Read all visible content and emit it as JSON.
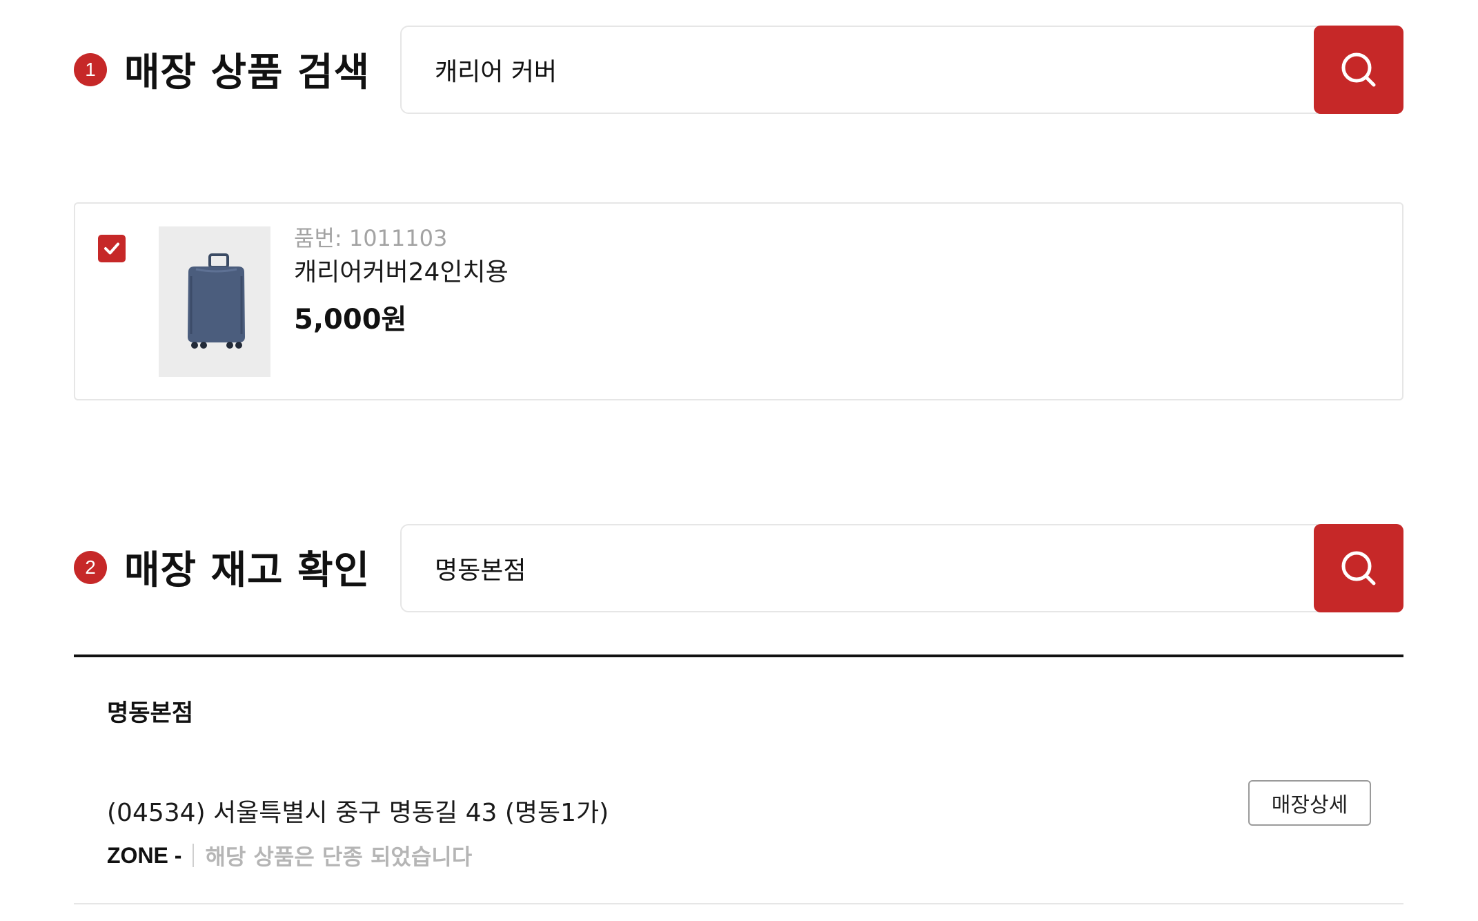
{
  "section1": {
    "step_number": "1",
    "title": "매장 상품 검색",
    "search_value": "캐리어 커버",
    "search_icon": "search-icon"
  },
  "product": {
    "checked": true,
    "sku": "품번: 1011103",
    "name": "캐리어커버24인치용",
    "price": "5,000원",
    "image": "luggage-cover-image"
  },
  "section2": {
    "step_number": "2",
    "title": "매장 재고 확인",
    "search_value": "명동본점",
    "search_icon": "search-icon"
  },
  "store": {
    "name": "명동본점",
    "address": "(04534) 서울특별시 중구 명동길 43 (명동1가)",
    "detail_button": "매장상세",
    "zone_label": "ZONE -",
    "status_text": "해당 상품은 단종 되었습니다"
  },
  "colors": {
    "accent": "#c62828",
    "muted_text": "#a3a3a3",
    "border": "#e6e6e6"
  }
}
